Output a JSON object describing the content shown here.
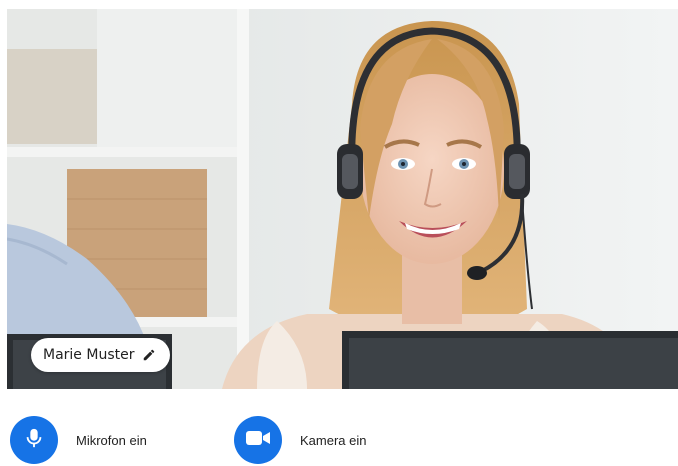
{
  "participant": {
    "name": "Marie Muster",
    "edit_icon": "pencil-icon"
  },
  "controls": {
    "microphone": {
      "label": "Mikrofon ein",
      "icon": "microphone-icon"
    },
    "camera": {
      "label": "Kamera ein",
      "icon": "video-camera-icon"
    }
  },
  "colors": {
    "accent": "#1673e6",
    "chip_bg": "#ffffff"
  }
}
